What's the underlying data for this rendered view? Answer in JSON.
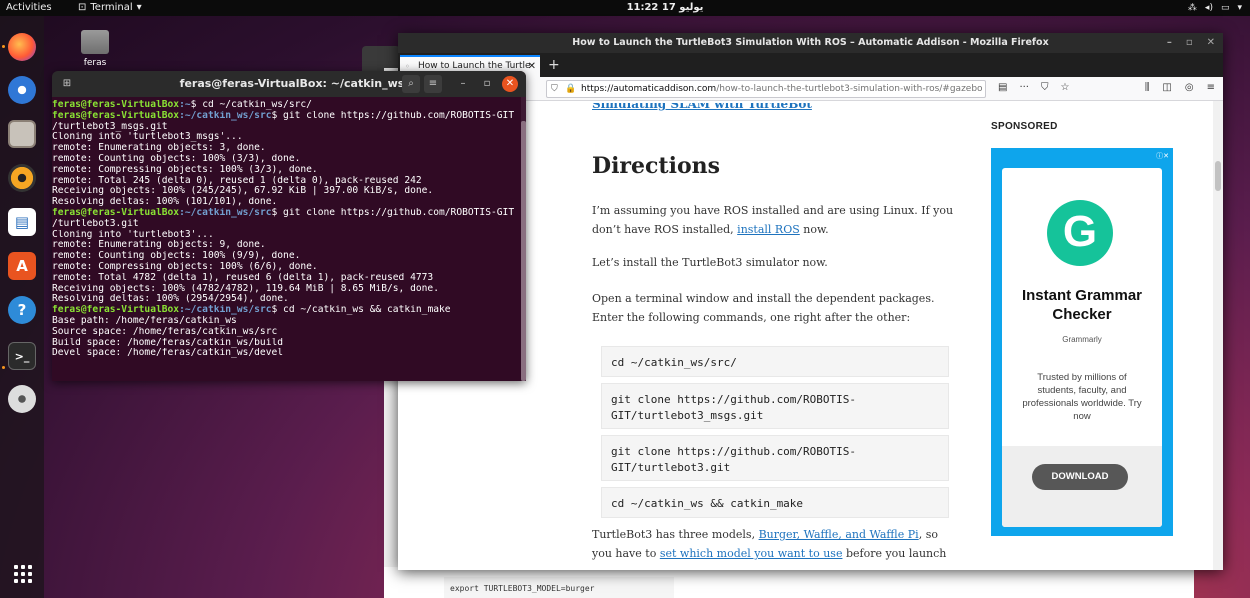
{
  "topbar": {
    "activities": "Activities",
    "app_menu": "Terminal",
    "clock": "يوليو 17  11:22"
  },
  "desktop": {
    "home_label": "feras"
  },
  "terminal": {
    "title": "feras@feras-VirtualBox: ~/catkin_ws",
    "lines": [
      {
        "user": "feras@feras-VirtualBox",
        "path": ":~",
        "cmd": "$ cd ~/catkin_ws/src/"
      },
      {
        "user": "feras@feras-VirtualBox",
        "path": ":~/catkin_ws/src",
        "cmd": "$ git clone https://github.com/ROBOTIS-GIT"
      },
      {
        "text": "/turtlebot3_msgs.git"
      },
      {
        "text": "Cloning into 'turtlebot3_msgs'..."
      },
      {
        "text": "remote: Enumerating objects: 3, done."
      },
      {
        "text": "remote: Counting objects: 100% (3/3), done."
      },
      {
        "text": "remote: Compressing objects: 100% (3/3), done."
      },
      {
        "text": "remote: Total 245 (delta 0), reused 1 (delta 0), pack-reused 242"
      },
      {
        "text": "Receiving objects: 100% (245/245), 67.92 KiB | 397.00 KiB/s, done."
      },
      {
        "text": "Resolving deltas: 100% (101/101), done."
      },
      {
        "user": "feras@feras-VirtualBox",
        "path": ":~/catkin_ws/src",
        "cmd": "$ git clone https://github.com/ROBOTIS-GIT"
      },
      {
        "text": "/turtlebot3.git"
      },
      {
        "text": "Cloning into 'turtlebot3'..."
      },
      {
        "text": "remote: Enumerating objects: 9, done."
      },
      {
        "text": "remote: Counting objects: 100% (9/9), done."
      },
      {
        "text": "remote: Compressing objects: 100% (6/6), done."
      },
      {
        "text": "remote: Total 4782 (delta 1), reused 6 (delta 1), pack-reused 4773"
      },
      {
        "text": "Receiving objects: 100% (4782/4782), 119.64 MiB | 8.65 MiB/s, done."
      },
      {
        "text": "Resolving deltas: 100% (2954/2954), done."
      },
      {
        "user": "feras@feras-VirtualBox",
        "path": ":~/catkin_ws/src",
        "cmd": "$ cd ~/catkin_ws && catkin_make"
      },
      {
        "text": "Base path: /home/feras/catkin_ws"
      },
      {
        "text": "Source space: /home/feras/catkin_ws/src"
      },
      {
        "text": "Build space: /home/feras/catkin_ws/build"
      },
      {
        "text": "Devel space: /home/feras/catkin_ws/devel"
      }
    ]
  },
  "firefox": {
    "window_title": "How to Launch the TurtleBot3 Simulation With ROS – Automatic Addison - Mozilla Firefox",
    "tab_title": "How to Launch the Turtle",
    "url_domain": "https://automaticaddison.com",
    "url_path": "/how-to-launch-the-turtlebot3-simulation-with-ros/#gazebo"
  },
  "article": {
    "top_link": "Simulating SLAM with TurtleBot",
    "heading": "Directions",
    "p1_before": "I’m assuming you have ROS installed and are using Linux. If you don’t have ROS installed, ",
    "p1_link": "install ROS",
    "p1_after": " now.",
    "p2": "Let’s install the TurtleBot3 simulator now.",
    "p3": "Open a terminal window and install the dependent packages. Enter the following commands, one right after the other:",
    "code1": "cd ~/catkin_ws/src/",
    "code2": "git clone https://github.com/ROBOTIS-\nGIT/turtlebot3_msgs.git",
    "code3": "git clone https://github.com/ROBOTIS-\nGIT/turtlebot3.git",
    "code4": "cd ~/catkin_ws && catkin_make",
    "p4_before": "TurtleBot3 has three models, ",
    "p4_link": "Burger, Waffle, and Waffle Pi",
    "p4_mid": ", so you have to ",
    "p4_link2": "set which model you want to use",
    "p4_after": " before you launch",
    "behind_code": "export TURTLEBOT3_MODEL=burger"
  },
  "sidebar": {
    "sponsored": "SPONSORED",
    "ad": {
      "headline": "Instant Grammar Checker",
      "brand": "Grammarly",
      "description": "Trusted by millions of students, faculty, and professionals worldwide. Try now",
      "button": "DOWNLOAD"
    }
  },
  "colors": {
    "terminal_bg": "#300a24",
    "prompt_user": "#8ae234",
    "prompt_path": "#729fcf",
    "link": "#1e73be",
    "ad_bg": "#0ea5ec",
    "grammarly_green": "#15c39a"
  }
}
